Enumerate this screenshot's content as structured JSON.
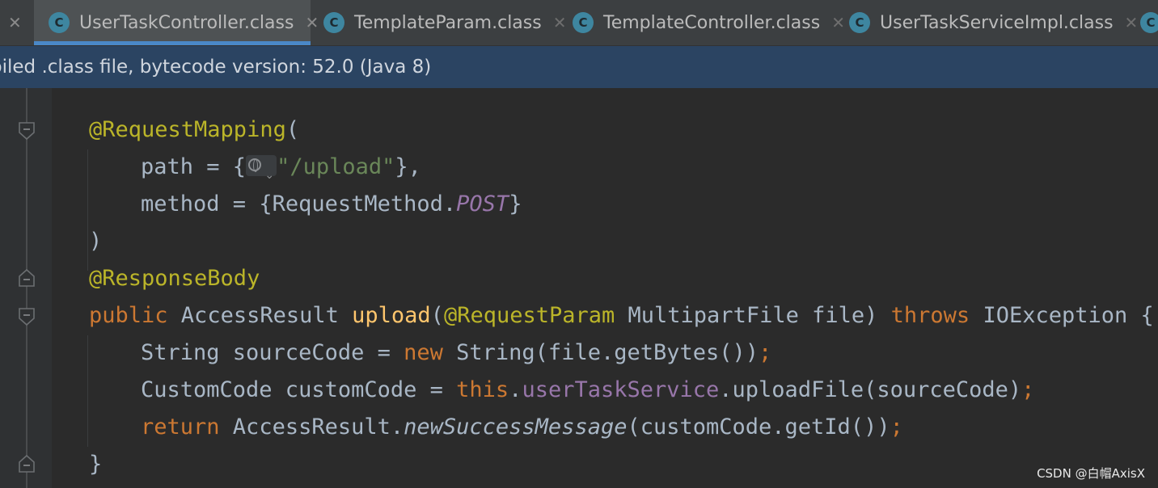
{
  "tabs": [
    {
      "label": "",
      "active": false
    },
    {
      "label": "UserTaskController.class",
      "active": true
    },
    {
      "label": "TemplateParam.class",
      "active": false
    },
    {
      "label": "TemplateController.class",
      "active": false
    },
    {
      "label": "UserTaskServiceImpl.class",
      "active": false
    }
  ],
  "tab_icon_letter": "C",
  "close_glyph": "✕",
  "banner": {
    "text": "piled .class file, bytecode version: 52.0 (Java 8)"
  },
  "code": {
    "line1": {
      "annotation": "@RequestMapping",
      "paren": "("
    },
    "line2": {
      "key": "path",
      "eq": " = {",
      "url": "\"/upload\"",
      "close": "},"
    },
    "line3": {
      "key": "method",
      "eq": " = {",
      "cls": "RequestMethod.",
      "const": "POST",
      "close": "}"
    },
    "line4": {
      "text": ")"
    },
    "line5": {
      "annotation": "@ResponseBody"
    },
    "line6": {
      "kw_public": "public",
      "ret_type": " AccessResult ",
      "method_name": "upload",
      "open": "(",
      "param_ann": "@RequestParam",
      "param_rest": " MultipartFile file) ",
      "kw_throws": "throws",
      "exc": " IOException {"
    },
    "line7": {
      "pre": "String sourceCode = ",
      "kw_new": "new",
      "post": " String(file.getBytes())",
      "semi": ";"
    },
    "line8": {
      "pre": "CustomCode customCode = ",
      "kw_this": "this",
      "dot": ".",
      "field": "userTaskService",
      "post": ".uploadFile(sourceCode)",
      "semi": ";"
    },
    "line9": {
      "kw_return": "return",
      "cls": " AccessResult.",
      "static_call": "newSuccessMessage",
      "post": "(customCode.getId())",
      "semi": ";"
    },
    "line10": {
      "text": "}"
    }
  },
  "watermark": "CSDN @白帽AxisX",
  "colors": {
    "keyword": "#cc7832",
    "annotation": "#bbb529",
    "string": "#6a8759",
    "method_decl": "#ffc66d",
    "field": "#9876aa",
    "default_text": "#a9b7c6",
    "background": "#2b2b2b",
    "banner": "#2b4462",
    "tab_underline": "#4a88c7"
  }
}
